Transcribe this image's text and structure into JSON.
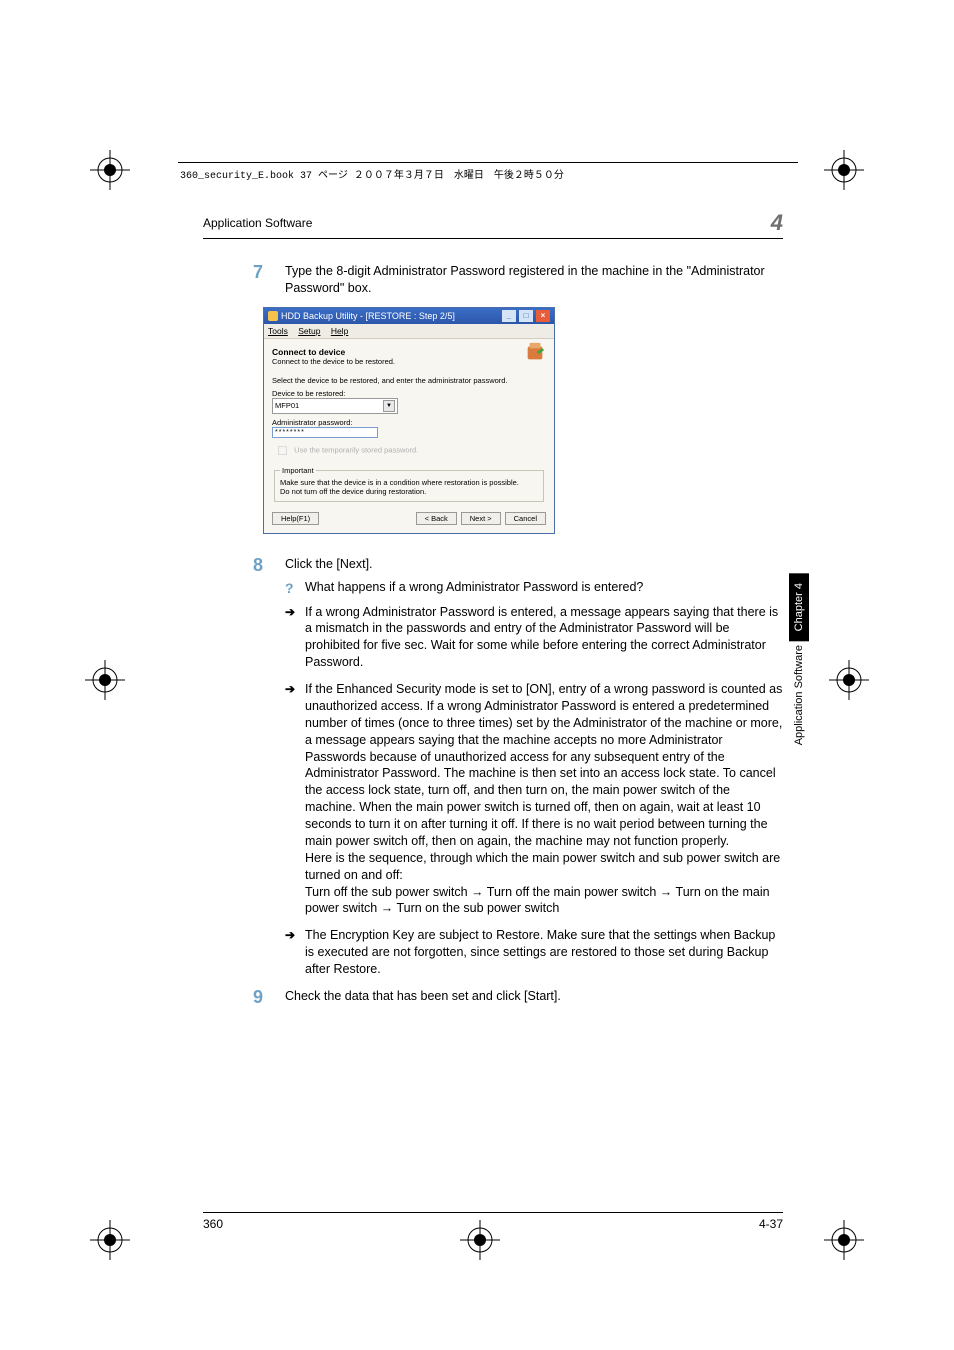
{
  "header_line": "360_security_E.book  37 ページ  ２００７年３月７日　水曜日　午後２時５０分",
  "running_header": {
    "title": "Application Software",
    "chapter_number": "4"
  },
  "sidebar": {
    "chapter": "Chapter 4",
    "section": "Application Software"
  },
  "footer": {
    "left": "360",
    "right": "4-37"
  },
  "step7": {
    "num": "7",
    "text": "Type the 8-digit Administrator Password registered in the machine in the \"Administrator Password\" box."
  },
  "screenshot": {
    "title": "HDD Backup Utility - [RESTORE : Step 2/5]",
    "menu": {
      "tools": "Tools",
      "setup": "Setup",
      "help": "Help"
    },
    "heading": "Connect to device",
    "subheading": "Connect to the device to be restored.",
    "instruction": "Select the device to be restored, and enter the administrator password.",
    "device_label": "Device to be restored:",
    "device_value": "MFP01",
    "pwd_label": "Administrator password:",
    "pwd_value": "********",
    "checkbox_label": "Use the temporarily stored password.",
    "fieldset_legend": "Important",
    "fieldset_text1": "Make sure that the device is in a condition where restoration is possible.",
    "fieldset_text2": "Do not turn off the device during restoration.",
    "btn_help": "Help(F1)",
    "btn_back": "< Back",
    "btn_next": "Next >",
    "btn_cancel": "Cancel"
  },
  "step8": {
    "num": "8",
    "text": "Click the [Next].",
    "q": "What happens if a wrong Administrator Password is entered?",
    "a1": "If a wrong Administrator Password is entered, a message appears saying that there is a mismatch in the passwords and entry of the Administrator Password will be prohibited for five sec. Wait for some while before entering the correct Administrator Password.",
    "a2_part1": "If the Enhanced Security mode is set to [ON], entry of a wrong password is counted as unauthorized access. If a wrong Administrator Password is entered a predetermined number of times (once to three times) set by the Administrator of the machine or more, a message appears saying that the machine accepts no more Administrator Passwords because of unauthorized access for any subsequent entry of the Administrator Password. The machine is then set into an access lock state. To cancel the access lock state, turn off, and then turn on, the main power switch of the machine. When the main power switch is turned off, then on again, wait at least 10 seconds to turn it on after turning it off. If there is no wait period between turning the main power switch off, then on again, the machine may not function properly.",
    "a2_part2": "Here is the sequence, through which the main power switch and sub power switch are turned on and off:",
    "a2_part3": "Turn off the sub power switch → Turn off the main power switch → Turn on the main power switch → Turn on the sub power switch",
    "a3": "The Encryption Key are subject to Restore. Make sure that the settings when Backup is executed are not forgotten, since settings are restored to those set during Backup after Restore."
  },
  "step9": {
    "num": "9",
    "text": "Check the data that has been set and click [Start]."
  }
}
